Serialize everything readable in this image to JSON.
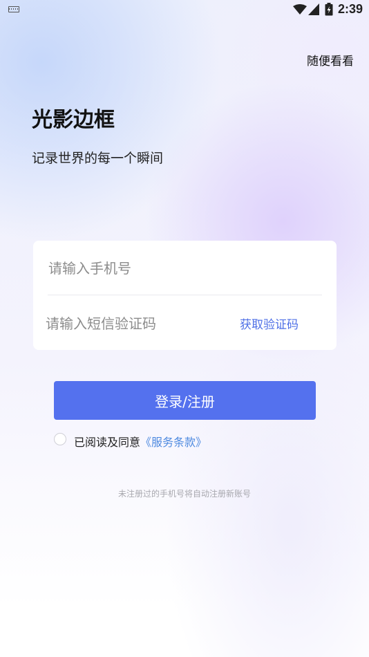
{
  "status_bar": {
    "time": "2:39",
    "icons": [
      "keyboard-icon",
      "wifi-icon",
      "signal-icon",
      "battery-icon"
    ]
  },
  "header": {
    "skip_label": "随便看看"
  },
  "hero": {
    "title": "光影边框",
    "slogan": "记录世界的每一个瞬间"
  },
  "form": {
    "phone_placeholder": "请输入手机号",
    "phone_value": "",
    "code_placeholder": "请输入短信验证码",
    "code_value": "",
    "get_code_label": "获取验证码"
  },
  "login_button_label": "登录/注册",
  "agreement": {
    "checked": false,
    "prefix": "已阅读及同意",
    "terms_label": "《服务条款》"
  },
  "footer_note": "未注册过的手机号将自动注册新账号",
  "colors": {
    "primary": "#5471ee",
    "link": "#4e8ae0",
    "get_code": "#4e6fe6"
  }
}
